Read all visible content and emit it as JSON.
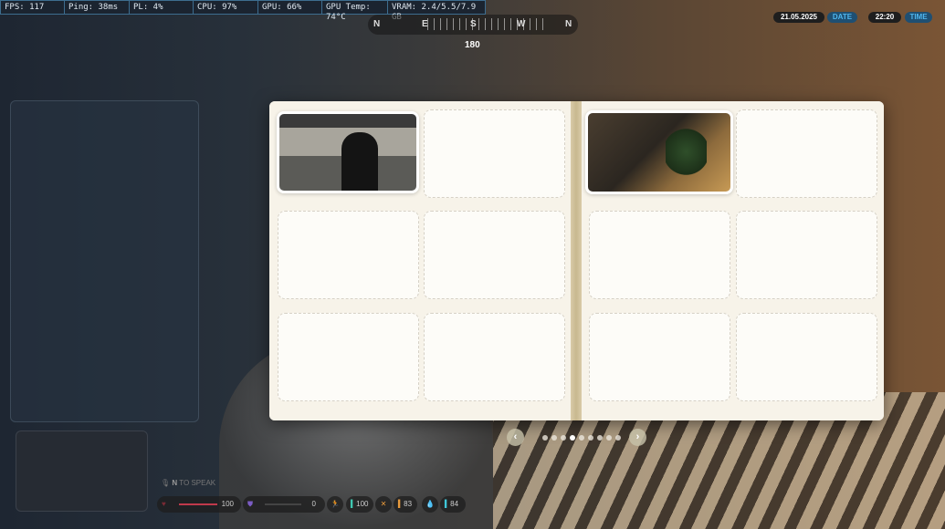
{
  "stats": [
    "FPS: 117",
    "Ping: 38ms",
    "PL: 4%",
    "CPU: 97%",
    "GPU: 66%",
    "GPU Temp: 74°C",
    "VRAM: 2.4/5.5/7.9 GB"
  ],
  "compass": {
    "letters": [
      "N",
      "E",
      "S",
      "W",
      "N"
    ],
    "heading": "180"
  },
  "datetime": {
    "date": "21.05.2025",
    "date_label": "DATE",
    "time": "22:20",
    "time_label": "TIME"
  },
  "album": {
    "photos": [
      "photo-office-character",
      "photo-office-desk-plant"
    ],
    "dots": 9,
    "active_dot": 4
  },
  "hud": {
    "push_to_talk_key": "N",
    "push_to_talk_text": "TO SPEAK",
    "health": "100",
    "armor": "0",
    "stamina": "100",
    "hunger": "83",
    "thirst": "84"
  },
  "colors": {
    "health": "#c0394b",
    "armor": "#7b5cc4",
    "stamina": "#3fc7b0",
    "hunger": "#e89a3c",
    "thirst": "#3fc7d8",
    "accent": "#4fb6ee"
  }
}
